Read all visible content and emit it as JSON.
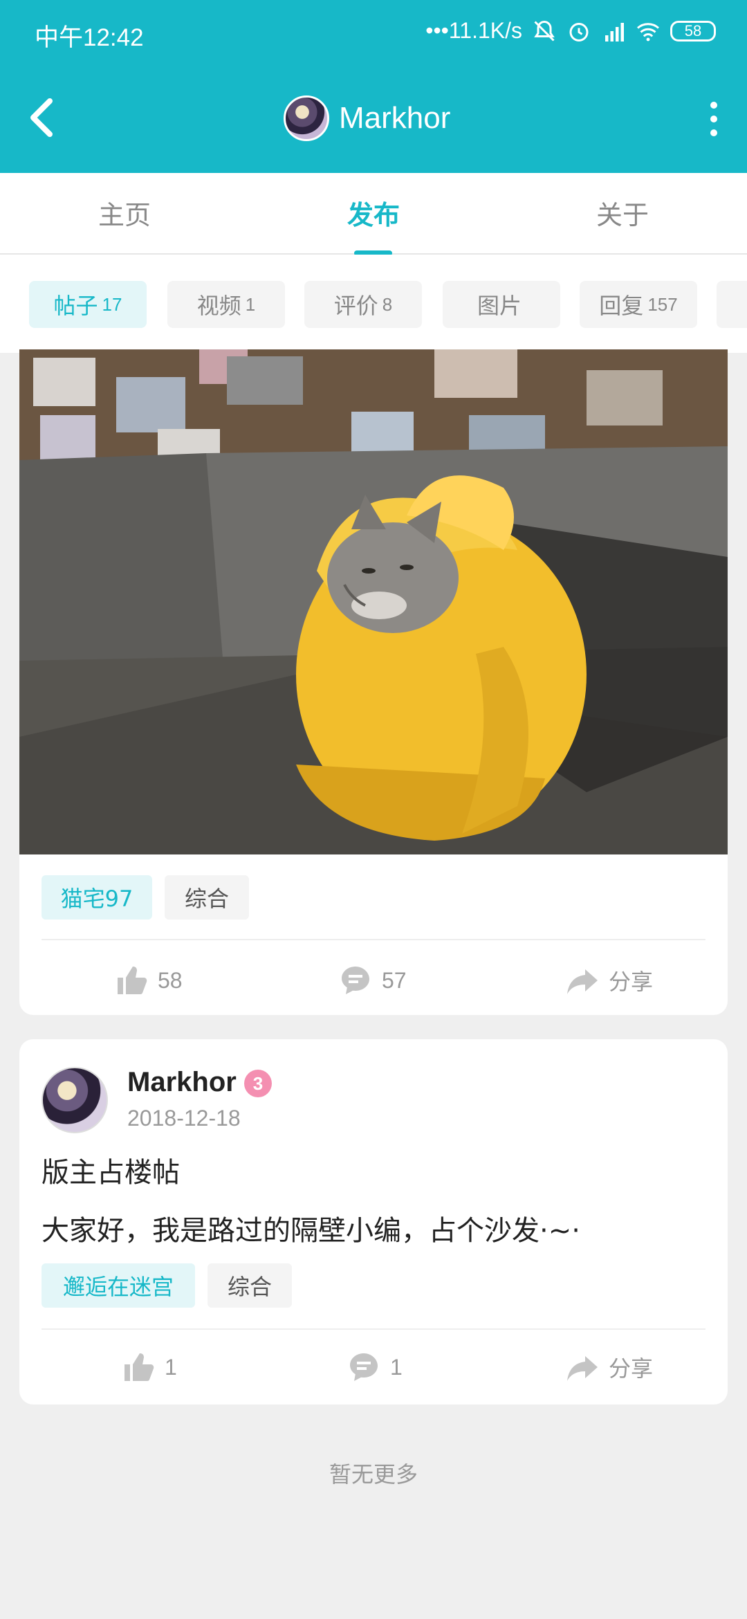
{
  "status_bar": {
    "time": "中午12:42",
    "network_speed": "•••11.1K/s",
    "battery": "58",
    "icons": [
      "mute-bell-icon",
      "alarm-icon",
      "hd-signal-icon",
      "wifi-icon",
      "battery-icon"
    ]
  },
  "navbar": {
    "title": "Markhor",
    "back_icon": "chevron-left-icon",
    "more_icon": "more-vertical-icon"
  },
  "tabs": [
    {
      "label": "主页",
      "active": false
    },
    {
      "label": "发布",
      "active": true
    },
    {
      "label": "关于",
      "active": false
    }
  ],
  "filters": [
    {
      "label": "帖子",
      "count": "17",
      "active": true
    },
    {
      "label": "视频",
      "count": "1",
      "active": false
    },
    {
      "label": "评价",
      "count": "8",
      "active": false
    },
    {
      "label": "图片",
      "count": "",
      "active": false
    },
    {
      "label": "回复",
      "count": "157",
      "active": false
    }
  ],
  "posts": [
    {
      "image": "cat-in-yellow-banana-bed-photo",
      "tags": [
        "猫宅97",
        "综合"
      ],
      "likes": "58",
      "comments": "57",
      "share": "分享"
    },
    {
      "author": "Markhor",
      "badge": "3",
      "date": "2018-12-18",
      "title": "版主占楼帖",
      "body": "大家好，我是路过的隔壁小编，占个沙发·~·",
      "tags": [
        "邂逅在迷宫",
        "综合"
      ],
      "likes": "1",
      "comments": "1",
      "share": "分享"
    }
  ],
  "footer": {
    "no_more": "暂无更多"
  },
  "colors": {
    "accent": "#17b8c8",
    "background": "#efefef",
    "card": "#ffffff"
  }
}
